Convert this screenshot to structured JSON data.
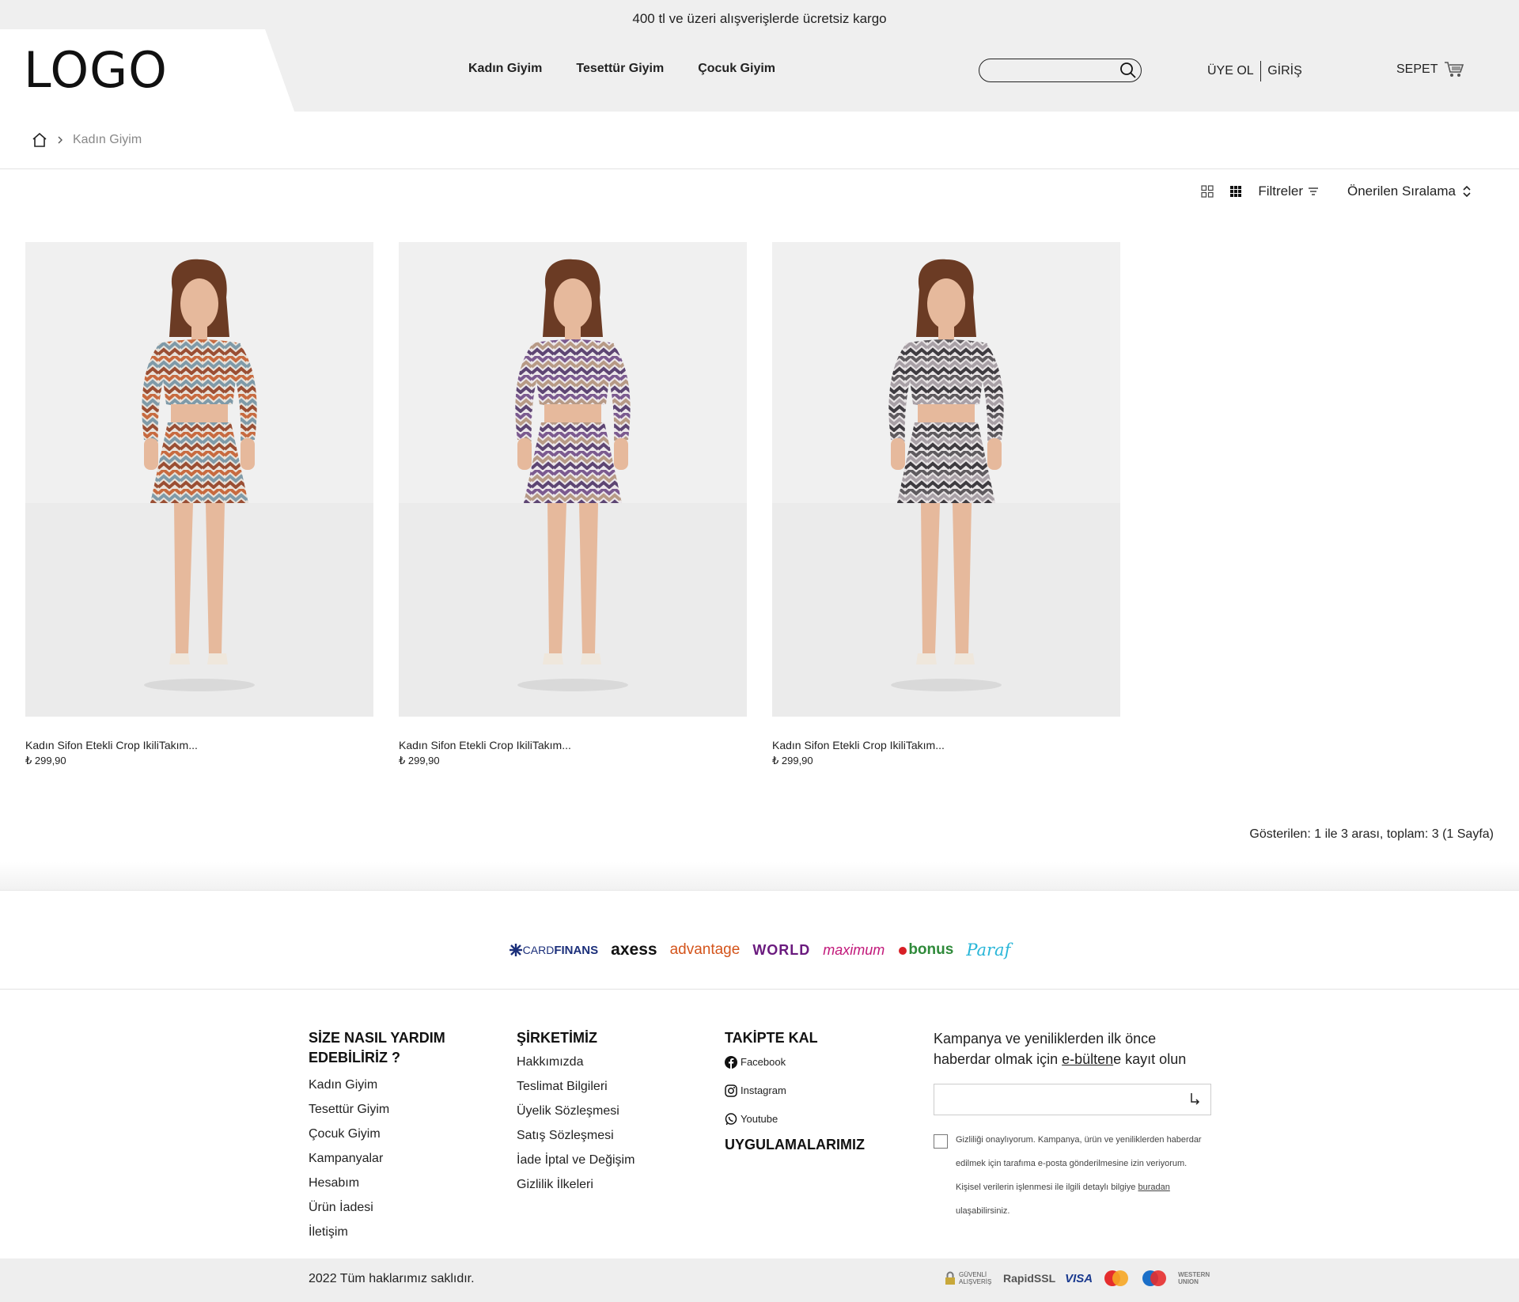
{
  "promo": "400 tl ve üzeri alışverişlerde ücretsiz kargo",
  "logo": "LOGO",
  "nav": [
    "Kadın Giyim",
    "Tesettür Giyim",
    "Çocuk Giyim"
  ],
  "search": {
    "placeholder": ""
  },
  "auth": {
    "register": "ÜYE OL",
    "login": "GİRİŞ"
  },
  "cart": {
    "label": "SEPET"
  },
  "breadcrumb": {
    "current": "Kadın Giyim"
  },
  "toolbar": {
    "filters": "Filtreler",
    "sort": "Önerilen Sıralama"
  },
  "products": [
    {
      "name": "Kadın Sifon Etekli Crop IkiliTakım...",
      "price": "₺ 299,90",
      "palette": [
        "#c76a3f",
        "#7f9aa8",
        "#e8e2da",
        "#9a4e33"
      ]
    },
    {
      "name": "Kadın Sifon Etekli Crop IkiliTakım...",
      "price": "₺ 299,90",
      "palette": [
        "#7b5a8f",
        "#b79a86",
        "#ece7ea",
        "#5d4573"
      ]
    },
    {
      "name": "Kadın Sifon Etekli Crop IkiliTakım...",
      "price": "₺ 299,90",
      "palette": [
        "#5e5a5e",
        "#a8a0a6",
        "#e7e3e4",
        "#3e3b40"
      ]
    }
  ],
  "results": "Gösterilen: 1 ile 3 arası, toplam: 3 (1 Sayfa)",
  "banks": {
    "cardfinans": {
      "a": "CARD",
      "b": "FINANS"
    },
    "axess": "axess",
    "advantage": "advantage",
    "world": "WORLD",
    "maximum": "maximum",
    "bonus": "bonus",
    "paraf": "Paraf"
  },
  "footer": {
    "help": {
      "title": "SİZE NASIL YARDIM EDEBİLİRİZ ?",
      "items": [
        "Kadın Giyim",
        "Tesettür Giyim",
        "Çocuk Giyim",
        "Kampanyalar",
        "Hesabım",
        "Ürün İadesi",
        "İletişim"
      ]
    },
    "company": {
      "title": "ŞİRKETİMİZ",
      "items": [
        "Hakkımızda",
        "Teslimat Bilgileri",
        "Üyelik Sözleşmesi",
        "Satış Sözleşmesi",
        "İade İptal ve Değişim",
        "Gizlilik İlkeleri"
      ]
    },
    "follow": {
      "title": "TAKİPTE KAL",
      "items": [
        "Facebook",
        "Instagram",
        "Youtube"
      ],
      "apps": "UYGULAMALARIMIZ"
    },
    "newsletter": {
      "p1": "Kampanya ve yeniliklerden ilk önce haberdar olmak için ",
      "link": "e-bülten",
      "p2": "e kayıt olun",
      "consent1": "Gizliliği onaylıyorum. Kampanya, ürün ve yeniliklerden haberdar edilmek için tarafıma e-posta gönderilmesine izin veriyorum. Kişisel verilerin işlenmesi ile ilgili detaylı bilgiye ",
      "consent_link": "buradan",
      "consent2": " ulaşabilirsiniz."
    }
  },
  "copyright": "2022 Tüm haklarımız saklıdır.",
  "payments": {
    "secure": "GÜVENLİ ALIŞVERİŞ",
    "ssl": "RapidSSL",
    "visa": "VISA",
    "western": "WESTERN UNION"
  },
  "colors": {
    "header_bg": "#efefef",
    "bottom_bg": "#eeeeee"
  }
}
